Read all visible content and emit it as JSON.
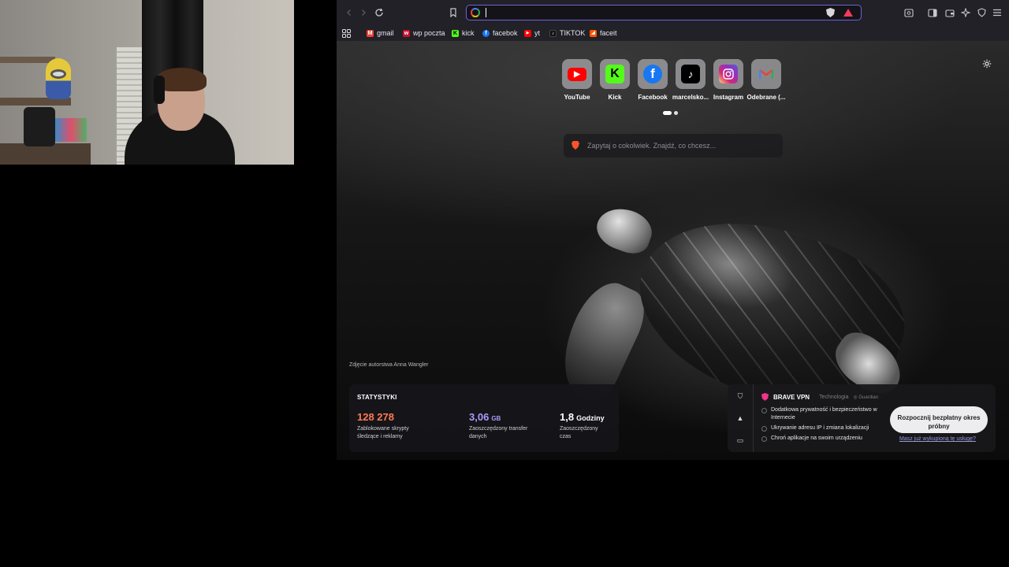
{
  "browser": {
    "url_value": "",
    "bookmarks": [
      {
        "label": "gmail",
        "icon": "gmail-icon"
      },
      {
        "label": "wp poczta",
        "icon": "wp-icon"
      },
      {
        "label": "kick",
        "icon": "kick-icon"
      },
      {
        "label": "facebok",
        "icon": "facebook-icon"
      },
      {
        "label": "yt",
        "icon": "youtube-icon"
      },
      {
        "label": "TIKTOK",
        "icon": "tiktok-icon"
      },
      {
        "label": "faceit",
        "icon": "faceit-icon"
      }
    ]
  },
  "ntp": {
    "top_sites": [
      {
        "label": "YouTube",
        "icon": "youtube-icon",
        "color": "#ff0000"
      },
      {
        "label": "Kick",
        "icon": "kick-icon",
        "color": "#53fc18"
      },
      {
        "label": "Facebook",
        "icon": "facebook-icon",
        "color": "#1877f2"
      },
      {
        "label": "marcelsko...",
        "icon": "tiktok-icon",
        "color": "#000000"
      },
      {
        "label": "Instagram",
        "icon": "instagram-icon",
        "color": "#e1306c"
      },
      {
        "label": "Odebrane (...",
        "icon": "gmail-icon",
        "color": "#ea4335"
      }
    ],
    "search_placeholder": "Zapytaj o cokolwiek. Znajdź, co chcesz...",
    "photo_credit": "Zdjęcie autorstwa Anna Wangler"
  },
  "stats": {
    "title": "STATYSTYKI",
    "items": [
      {
        "value": "128 278",
        "unit": "",
        "label": "Zablokowane skrypty śledzące i reklamy",
        "color": "#ff7a55"
      },
      {
        "value": "3,06",
        "unit": "GB",
        "label": "Zaoszczędzony transfer danych",
        "color": "#a99bff"
      },
      {
        "value": "1,8",
        "unit": "Godziny",
        "label": "Zaoszczędzony czas",
        "color": "#ffffff"
      }
    ]
  },
  "vpn": {
    "title": "BRAVE VPN",
    "tech_label": "Technologia",
    "partner": "Guardian",
    "features": [
      "Dodatkowa prywatność i bezpieczeństwo w Internecie",
      "Ukrywanie adresu IP i zmiana lokalizacji",
      "Chroń aplikacje na swoim urządzeniu"
    ],
    "cta": "Rozpocznij bezpłatny okres próbny",
    "link": "Masz już wykupioną tę usługę?"
  }
}
